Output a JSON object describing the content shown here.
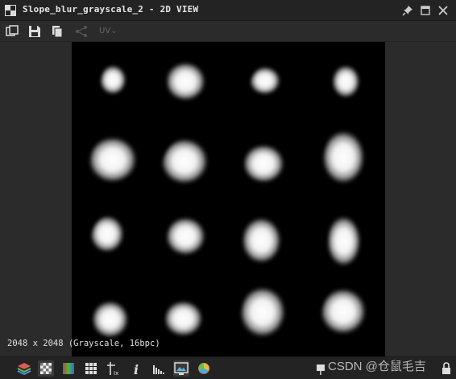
{
  "window": {
    "title": "Slope_blur_grayscale_2 - 2D VIEW"
  },
  "toolbar": {
    "uv_label": "UV",
    "icons": [
      "export-icon",
      "save-icon",
      "copy-icon",
      "share-icon",
      "uv-dropdown"
    ]
  },
  "viewport": {
    "resolution_label": "2048 x 2048 (Grayscale, 16bpc)",
    "grid": "4x4 grayscale blobs"
  },
  "bottombar": {
    "icons": [
      "layers-icon",
      "transparency-icon",
      "color-icon",
      "tile-icon",
      "pixel-info-icon",
      "info-icon",
      "histogram-icon",
      "view-icon",
      "color-wheel-icon",
      "pin-icon",
      "lock-icon"
    ]
  },
  "watermark": {
    "text": "CSDN @仓鼠毛吉"
  },
  "colors": {
    "bg": "#2b2b2b",
    "titlebar": "#232323",
    "canvas": "#000000"
  }
}
